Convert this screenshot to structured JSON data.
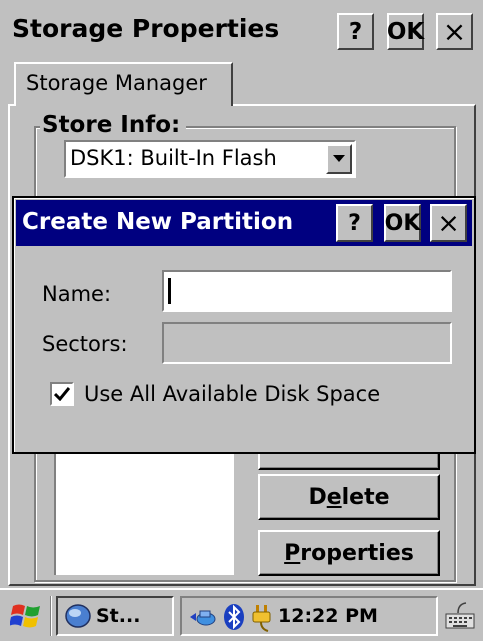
{
  "window": {
    "title": "Storage Properties",
    "help_label": "?",
    "ok_label": "OK",
    "close_label": "×"
  },
  "tabs": [
    {
      "label": "Storage Manager",
      "selected": true
    }
  ],
  "store_info": {
    "group_label": "Store Info:",
    "selected_store": "DSK1: Built-In Flash"
  },
  "buttons": {
    "delete": {
      "label": "Delete",
      "accel_index": 1
    },
    "properties": {
      "label": "Properties",
      "accel_index": 0
    }
  },
  "dialog": {
    "title": "Create New Partition",
    "help_label": "?",
    "ok_label": "OK",
    "close_label": "×",
    "name_label": "Name:",
    "name_value": "",
    "sectors_label": "Sectors:",
    "sectors_value": "",
    "checkbox_label": "Use All Available Disk Space",
    "checkbox_checked": true
  },
  "taskbar": {
    "task_label": "St...",
    "clock": "12:22 PM"
  },
  "colors": {
    "face": "#c0c0c0",
    "dialog_title": "#000080",
    "highlight": "#ffffff",
    "shadow": "#808080"
  },
  "icons": [
    "windows-start-icon",
    "storage-app-icon",
    "network-icon",
    "bluetooth-icon",
    "power-plug-icon",
    "keyboard-icon",
    "desktop-switch-icon"
  ]
}
